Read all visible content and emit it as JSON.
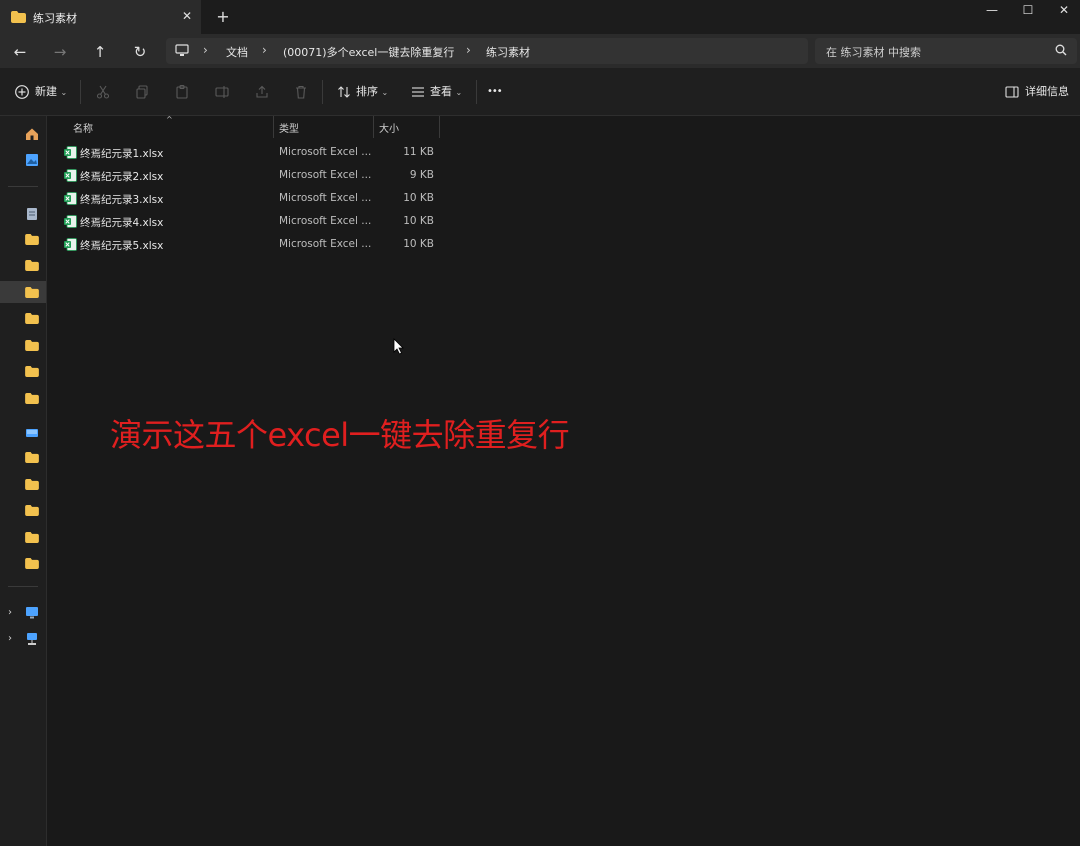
{
  "window": {
    "tab_title": "练习素材",
    "tab_close": "✕",
    "new_tab": "+",
    "minimize": "—",
    "maximize": "☐",
    "close": "✕"
  },
  "nav": {
    "back": "←",
    "forward": "→",
    "up": "↑",
    "refresh": "↻",
    "breadcrumbs": [
      "文档",
      "(00071)多个excel一键去除重复行",
      "练习素材"
    ],
    "separator": "›",
    "search_placeholder": "在 练习素材 中搜索"
  },
  "commands": {
    "new_label": "新建",
    "sort_label": "排序",
    "view_label": "查看",
    "more_label": "•••",
    "details_label": "详细信息"
  },
  "columns": {
    "name": "名称",
    "type": "类型",
    "size": "大小"
  },
  "files": [
    {
      "name": "终焉纪元录1.xlsx",
      "type": "Microsoft Excel ...",
      "size": "11 KB"
    },
    {
      "name": "终焉纪元录2.xlsx",
      "type": "Microsoft Excel ...",
      "size": "9 KB"
    },
    {
      "name": "终焉纪元录3.xlsx",
      "type": "Microsoft Excel ...",
      "size": "10 KB"
    },
    {
      "name": "终焉纪元录4.xlsx",
      "type": "Microsoft Excel ...",
      "size": "10 KB"
    },
    {
      "name": "终焉纪元录5.xlsx",
      "type": "Microsoft Excel ...",
      "size": "10 KB"
    }
  ],
  "caption": "演示这五个excel一键去除重复行",
  "colors": {
    "caption": "#e01f1f",
    "folder": "#f2c14e",
    "excel": "#1f9d55",
    "accent": "#4da3ff"
  }
}
